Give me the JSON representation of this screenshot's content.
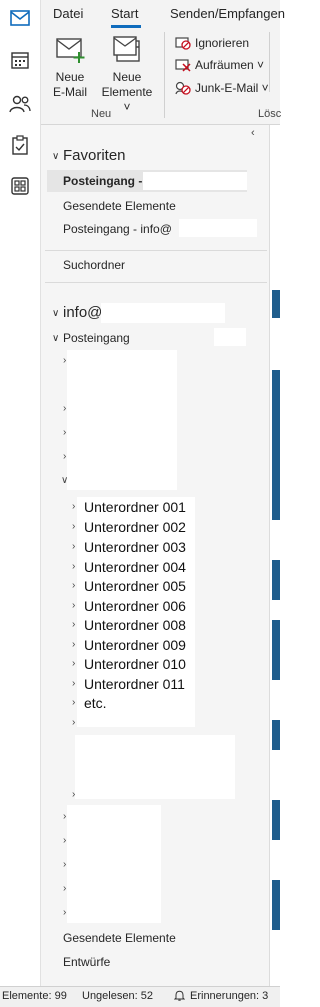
{
  "ribbon": {
    "tabs": [
      "Datei",
      "Start",
      "Senden/Empfangen"
    ],
    "new_email": [
      "Neue",
      "E-Mail"
    ],
    "new_items": [
      "Neue",
      "Elemente ˅"
    ],
    "group_new": "Neu",
    "ignore": "Ignorieren",
    "cleanup": "Aufräumen ˅",
    "junk": "Junk-E-Mail ˅",
    "group_delete": "Lösc"
  },
  "favorites": {
    "header": "Favoriten",
    "inbox_selected": "Posteingang -",
    "sent": "Gesendete Elemente",
    "inbox_info": "Posteingang - info@"
  },
  "search_folder": "Suchordner",
  "account": {
    "header": "info@",
    "inbox": "Posteingang"
  },
  "subfolders": [
    "Unterordner 001",
    "Unterordner 002",
    "Unterordner 003",
    "Unterordner 004",
    "Unterordner 005",
    "Unterordner 006",
    "Unterordner 008",
    "Unterordner 009",
    "Unterordner 010",
    "Unterordner 011",
    "etc."
  ],
  "bottom_folders": {
    "sent": "Gesendete Elemente",
    "drafts": "Entwürfe"
  },
  "status": {
    "items": "Elemente: 99",
    "unread": "Ungelesen: 52",
    "reminders": "Erinnerungen: 3"
  },
  "colors": {
    "accent": "#0f6cbd",
    "mark": "#1f5d8c"
  },
  "icons": [
    "mail-icon",
    "calendar-icon",
    "people-icon",
    "tasks-icon",
    "apps-icon",
    "new-email-icon",
    "new-items-icon",
    "ignore-icon",
    "cleanup-icon",
    "junk-icon",
    "bell-icon"
  ]
}
